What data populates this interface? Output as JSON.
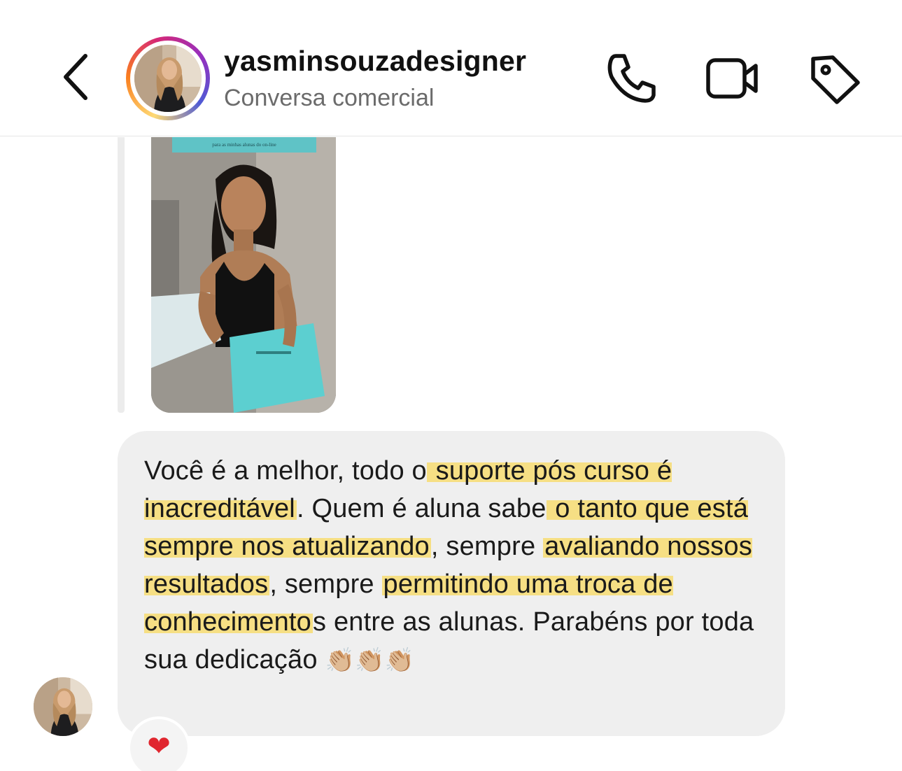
{
  "header": {
    "username": "yasminsouzadesigner",
    "subtitle": "Conversa comercial",
    "icons": [
      "back-chevron-icon",
      "phone-icon",
      "video-camera-icon",
      "tag-icon"
    ]
  },
  "media": {
    "caption": "para as minhas alunas do on-line"
  },
  "message": {
    "segments": [
      {
        "text": "Você é a melhor, todo o",
        "highlight": false
      },
      {
        "text": " suporte pós curso é inacreditável",
        "highlight": true
      },
      {
        "text": ". Quem é aluna sabe",
        "highlight": false
      },
      {
        "text": " o tanto que está sempre nos atualizando",
        "highlight": true
      },
      {
        "text": ", sempre ",
        "highlight": false
      },
      {
        "text": "avaliando nossos resultados",
        "highlight": true
      },
      {
        "text": ", sempre ",
        "highlight": false
      },
      {
        "text": "permitindo uma troca de conhecimento",
        "highlight": true
      },
      {
        "text": "s entre as alunas. Parabéns por toda sua dedicação ",
        "highlight": false
      }
    ],
    "emoji": "👏🏼👏🏼👏🏼"
  },
  "reaction": {
    "emoji": "❤"
  },
  "colors": {
    "highlight": "#f6df84",
    "bubble": "#efefef",
    "reaction_heart": "#e0262f"
  }
}
